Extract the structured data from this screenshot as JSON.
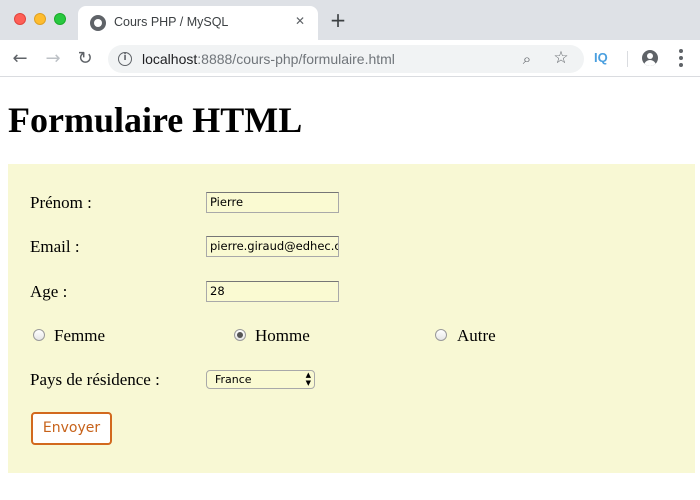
{
  "browser": {
    "tab": {
      "title": "Cours PHP / MySQL",
      "close_glyph": "✕",
      "favicon": "site-favicon-icon"
    },
    "new_tab_glyph": "+",
    "url": {
      "host": "localhost",
      "rest": ":8888/cours-php/formulaire.html"
    },
    "extension_label": "IQ",
    "icons": [
      "back-arrow-icon",
      "forward-arrow-icon",
      "reload-icon",
      "info-icon",
      "zoom-icon",
      "star-icon",
      "profile-icon",
      "menu-icon"
    ]
  },
  "page": {
    "title": "Formulaire HTML"
  },
  "form": {
    "background_color": "#f8f8d4",
    "input_color": "#fafad2",
    "prenom": {
      "label": "Prénom :",
      "value": "Pierre"
    },
    "email": {
      "label": "Email :",
      "value": "pierre.giraud@edhec.com"
    },
    "age": {
      "label": "Age :",
      "value": "28"
    },
    "sexe": {
      "options": [
        {
          "label": "Femme",
          "checked": false
        },
        {
          "label": "Homme",
          "checked": true
        },
        {
          "label": "Autre",
          "checked": false
        }
      ]
    },
    "pays": {
      "label": "Pays de résidence :",
      "selected": "France"
    },
    "submit_label": "Envoyer",
    "submit_color": "#d2691e"
  }
}
